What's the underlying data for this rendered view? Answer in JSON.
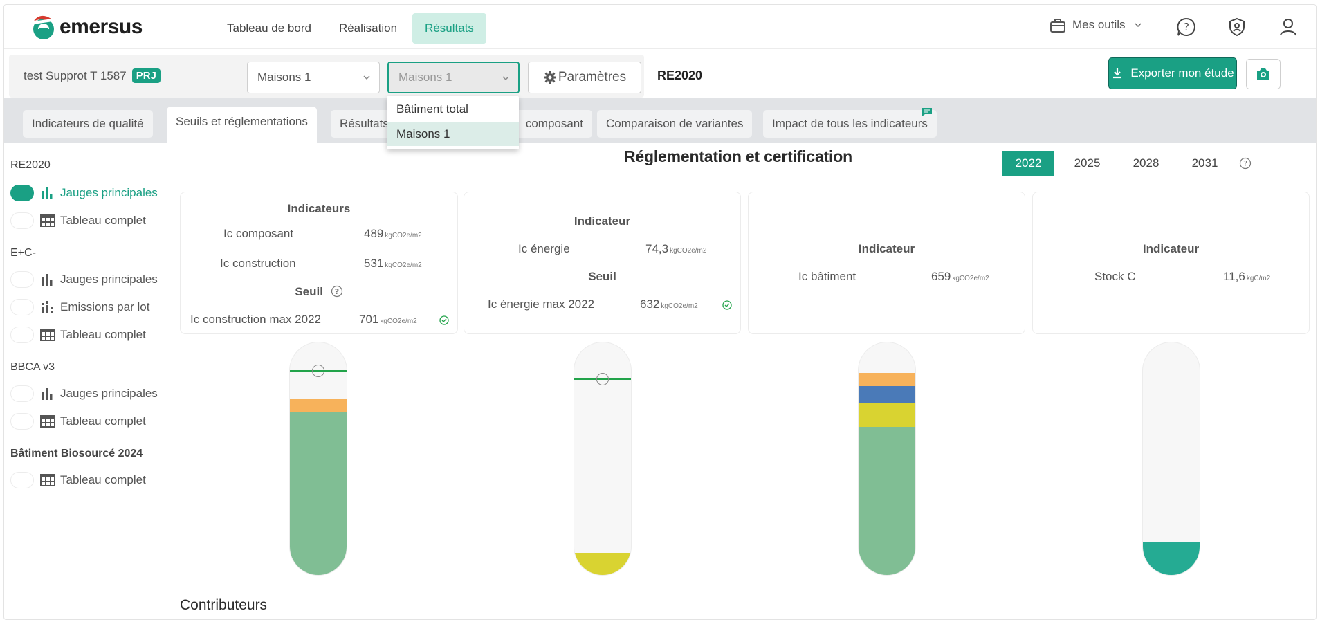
{
  "app": {
    "name": "emersus"
  },
  "nav": [
    "Tableau de bord",
    "Réalisation",
    "Résultats"
  ],
  "header": {
    "tools_label": "Mes outils"
  },
  "project": {
    "name": "test Supprot T 1587",
    "badge": "PRJ",
    "select1": "Maisons 1",
    "select2": "Maisons 1",
    "params_label": "Paramètres",
    "norm": "RE2020",
    "export_label": "Exporter mon étude"
  },
  "dropdown": {
    "options": [
      "Bâtiment total",
      "Maisons 1"
    ],
    "selected": "Maisons 1"
  },
  "tabs": [
    "Indicateurs de qualité",
    "Seuils et réglementations",
    "Résultats",
    "composant",
    "Comparaison de variantes",
    "Impact de tous les indicateurs"
  ],
  "sidebar": {
    "groups": [
      {
        "title": "RE2020",
        "items": [
          "Jauges principales",
          "Tableau complet"
        ]
      },
      {
        "title": "E+C-",
        "items": [
          "Jauges principales",
          "Emissions par lot",
          "Tableau complet"
        ]
      },
      {
        "title": "BBCA v3",
        "items": [
          "Jauges principales",
          "Tableau complet"
        ]
      },
      {
        "title": "Bâtiment Biosourcé 2024",
        "items": [
          "Tableau complet"
        ]
      }
    ]
  },
  "main": {
    "title": "Réglementation et certification",
    "years": [
      "2022",
      "2025",
      "2028",
      "2031"
    ],
    "active_year": "2022",
    "contributors_title": "Contributeurs"
  },
  "cards": [
    {
      "header": "Indicateurs",
      "rows": [
        {
          "label": "Ic composant",
          "value": "489",
          "unit": "kgCO2e/m2"
        },
        {
          "label": "Ic construction",
          "value": "531",
          "unit": "kgCO2e/m2"
        }
      ],
      "threshold_header": "Seuil",
      "threshold": {
        "label": "Ic construction max 2022",
        "value": "701",
        "unit": "kgCO2e/m2"
      }
    },
    {
      "header": "Indicateur",
      "rows": [
        {
          "label": "Ic énergie",
          "value": "74,3",
          "unit": "kgCO2e/m2"
        }
      ],
      "threshold_header": "Seuil",
      "threshold": {
        "label": "Ic énergie max 2022",
        "value": "632",
        "unit": "kgCO2e/m2"
      }
    },
    {
      "header": "Indicateur",
      "rows": [
        {
          "label": "Ic bâtiment",
          "value": "659",
          "unit": "kgCO2e/m2"
        }
      ]
    },
    {
      "header": "Indicateur",
      "rows": [
        {
          "label": "Stock C",
          "value": "11,6",
          "unit": "kgC/m2"
        }
      ]
    }
  ],
  "colors": {
    "accent": "#1aa084",
    "green": "#80be94",
    "orange": "#f7b25b",
    "blue": "#4a7ab8",
    "yellow": "#d9d331",
    "teal": "#25ab93",
    "threshold": "#22a34a"
  }
}
